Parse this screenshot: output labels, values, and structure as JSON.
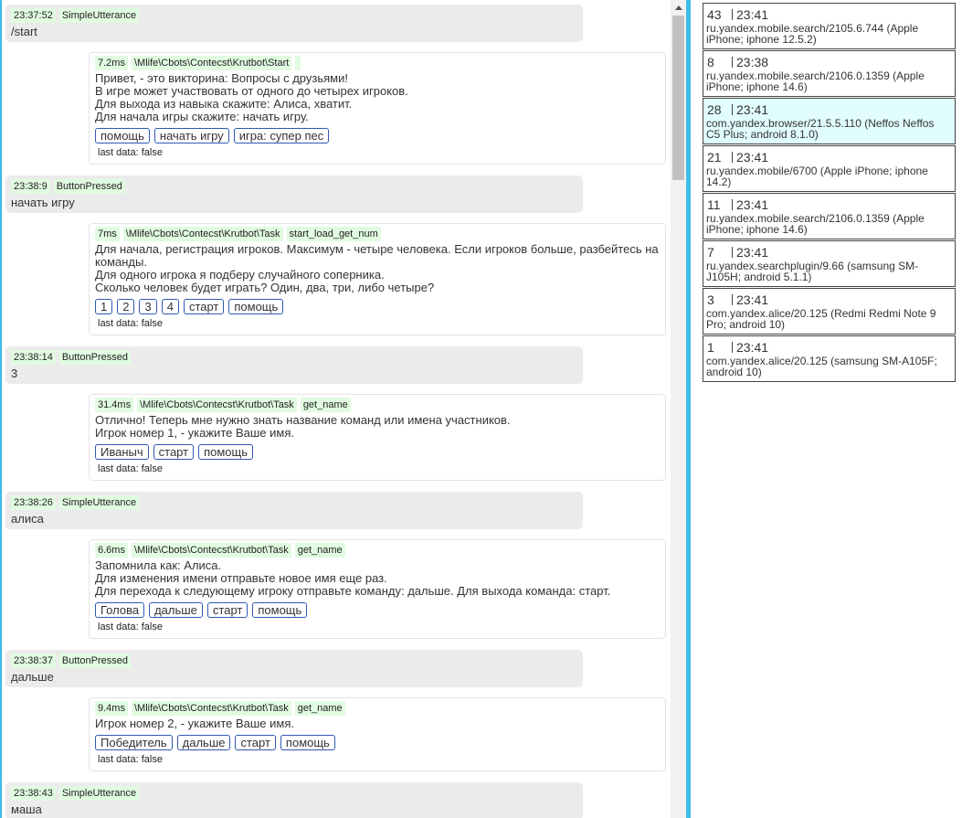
{
  "log": [
    {
      "request": {
        "time": "23:37:52",
        "type": "SimpleUtterance",
        "text": "/start"
      },
      "response": {
        "ms": "7.2ms",
        "path": "\\Mlife\\Cbots\\Contecst\\Krutbot\\Start",
        "state": "",
        "lines": [
          "Привет, - это викторина: Вопросы с друзьями!",
          "В игре может участвовать от одного до четырех игроков.",
          "Для выхода из навыка скажите: Алиса, хватит.",
          "Для начала игры скажите: начать игру."
        ],
        "buttons": [
          "помощь",
          "начать игру",
          "игра: супер пес"
        ],
        "last_data": "last data: false"
      }
    },
    {
      "request": {
        "time": "23:38:9",
        "type": "ButtonPressed",
        "text": "начать игру"
      },
      "response": {
        "ms": "7ms",
        "path": "\\Mlife\\Cbots\\Contecst\\Krutbot\\Task",
        "state": "start_load_get_num",
        "lines": [
          "Для начала, регистрация игроков. Максимум - четыре человека. Если игроков больше, разбейтесь на",
          "команды.",
          "Для одного игрока я подберу случайного соперника.",
          "Сколько человек будет играть? Один, два, три, либо четыре?"
        ],
        "buttons": [
          "1",
          "2",
          "3",
          "4",
          "старт",
          "помощь"
        ],
        "last_data": "last data: false"
      }
    },
    {
      "request": {
        "time": "23:38:14",
        "type": "ButtonPressed",
        "text": "3"
      },
      "response": {
        "ms": "31.4ms",
        "path": "\\Mlife\\Cbots\\Contecst\\Krutbot\\Task",
        "state": "get_name",
        "lines": [
          "Отлично! Теперь мне нужно знать название команд или имена участников.",
          "Игрок номер 1, - укажите Ваше имя."
        ],
        "buttons": [
          "Иваныч",
          "старт",
          "помощь"
        ],
        "last_data": "last data: false"
      }
    },
    {
      "request": {
        "time": "23:38:26",
        "type": "SimpleUtterance",
        "text": "алиса"
      },
      "response": {
        "ms": "6.6ms",
        "path": "\\Mlife\\Cbots\\Contecst\\Krutbot\\Task",
        "state": "get_name",
        "lines": [
          "Запомнила как: Алиса.",
          "Для изменения имени отправьте новое имя еще раз.",
          "Для перехода к следующему игроку отправьте команду: дальше. Для выхода команда: старт."
        ],
        "buttons": [
          "Голова",
          "дальше",
          "старт",
          "помощь"
        ],
        "last_data": "last data: false"
      }
    },
    {
      "request": {
        "time": "23:38:37",
        "type": "ButtonPressed",
        "text": "дальше"
      },
      "response": {
        "ms": "9.4ms",
        "path": "\\Mlife\\Cbots\\Contecst\\Krutbot\\Task",
        "state": "get_name",
        "lines": [
          "Игрок номер 2, - укажите Ваше имя."
        ],
        "buttons": [
          "Победитель",
          "дальше",
          "старт",
          "помощь"
        ],
        "last_data": "last data: false"
      }
    },
    {
      "request": {
        "time": "23:38:43",
        "type": "SimpleUtterance",
        "text": "маша"
      }
    }
  ],
  "sessions": [
    {
      "id": "43",
      "time": "23:41",
      "ua": "ru.yandex.mobile.search/2105.6.744 (Apple iPhone; iphone 12.5.2)",
      "active": false
    },
    {
      "id": "8",
      "time": "23:38",
      "ua": "ru.yandex.mobile.search/2106.0.1359 (Apple iPhone; iphone 14.6)",
      "active": false
    },
    {
      "id": "28",
      "time": "23:41",
      "ua": "com.yandex.browser/21.5.5.110 (Neffos Neffos C5 Plus; android 8.1.0)",
      "active": true
    },
    {
      "id": "21",
      "time": "23:41",
      "ua": "ru.yandex.mobile/6700 (Apple iPhone; iphone 14.2)",
      "active": false
    },
    {
      "id": "11",
      "time": "23:41",
      "ua": "ru.yandex.mobile.search/2106.0.1359 (Apple iPhone; iphone 14.6)",
      "active": false
    },
    {
      "id": "7",
      "time": "23:41",
      "ua": "ru.yandex.searchplugin/9.66 (samsung SM-J105H; android 5.1.1)",
      "active": false
    },
    {
      "id": "3",
      "time": "23:41",
      "ua": "com.yandex.alice/20.125 (Redmi Redmi Note 9 Pro; android 10)",
      "active": false
    },
    {
      "id": "1",
      "time": "23:41",
      "ua": "com.yandex.alice/20.125 (samsung SM-A105F; android 10)",
      "active": false
    }
  ],
  "colors": {
    "accent": "#3fbbe8",
    "tag_bg": "#e1fbe1",
    "button_border": "#2e59b2",
    "active_session_bg": "#e1fdfd"
  }
}
